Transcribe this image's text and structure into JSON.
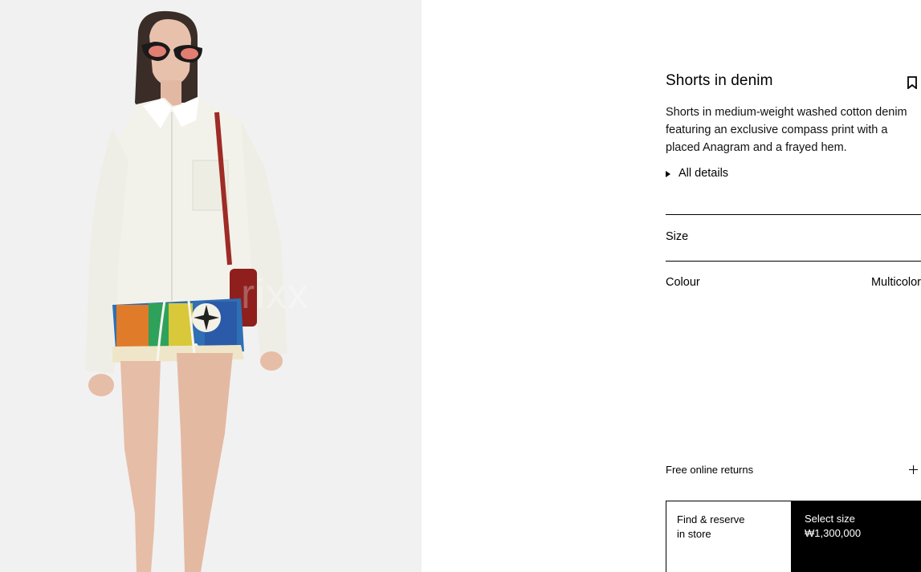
{
  "product": {
    "title": "Shorts in denim",
    "description": "Shorts in medium-weight washed cotton denim featuring an exclusive compass print with a placed Anagram and a frayed hem.",
    "details_label": "All details"
  },
  "size": {
    "label": "Size"
  },
  "colour": {
    "label": "Colour",
    "value": "Multicolor"
  },
  "returns": {
    "label": "Free online returns"
  },
  "actions": {
    "find_reserve_line1": "Find & reserve",
    "find_reserve_line2": "in store",
    "select_size_label": "Select size",
    "price": "₩1,300,000"
  },
  "image": {
    "watermark": "rixx"
  },
  "icons": {
    "bookmark": "bookmark-icon",
    "expand": "plus-icon",
    "disclosure": "triangle-right-icon"
  }
}
